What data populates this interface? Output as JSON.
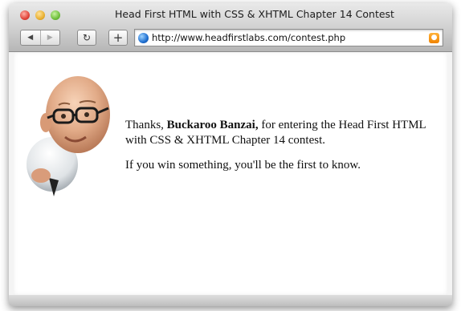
{
  "window": {
    "title": "Head First HTML with CSS & XHTML Chapter 14 Contest"
  },
  "toolbar": {
    "back_icon": "back-arrow-icon",
    "forward_icon": "forward-arrow-icon",
    "reload_icon": "reload-icon",
    "add_icon": "add-bookmark-icon",
    "url": "http://www.headfirstlabs.com/contest.php"
  },
  "content": {
    "thanks_prefix": "Thanks, ",
    "name": "Buckaroo Banzai,",
    "thanks_suffix": " for entering the Head First HTML with CSS & XHTML Chapter 14 contest.",
    "followup": "If you win something, you'll be the first to know."
  }
}
